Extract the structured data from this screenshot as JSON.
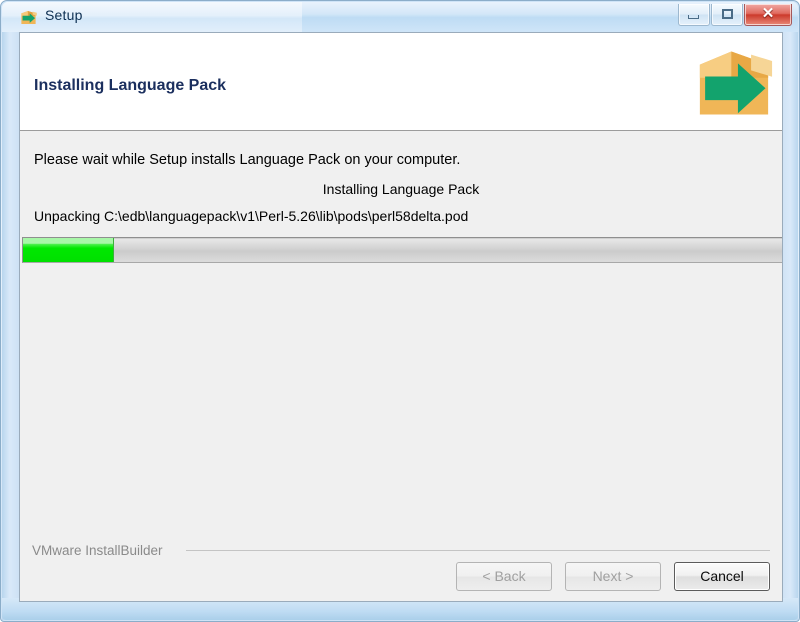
{
  "window": {
    "title": "Setup",
    "icon": "installer-box-arrow-icon",
    "controls": {
      "minimize": "minimize-icon",
      "maximize": "maximize-icon",
      "close": "✕"
    }
  },
  "header": {
    "title": "Installing Language Pack",
    "icon": "installer-box-arrow-icon"
  },
  "content": {
    "intro": "Please wait while Setup installs Language Pack on your computer.",
    "status": "Installing Language Pack",
    "detail": "Unpacking C:\\edb\\languagepack\\v1\\Perl-5.26\\lib\\pods\\perl58delta.pod"
  },
  "progress": {
    "percent": 12,
    "fill_color": "#00e800",
    "track_color": "#d2d2d2"
  },
  "footer": {
    "brand": "VMware InstallBuilder",
    "buttons": [
      {
        "label": "< Back",
        "name": "back-button",
        "enabled": false
      },
      {
        "label": "Next >",
        "name": "next-button",
        "enabled": false
      },
      {
        "label": "Cancel",
        "name": "cancel-button",
        "enabled": true
      }
    ]
  },
  "colors": {
    "header_title": "#1b2f5e",
    "body_bg": "#f0f0f0",
    "brand_text": "#8a8a8a",
    "accent_green": "#00e800",
    "box_orange": "#f0b657"
  }
}
